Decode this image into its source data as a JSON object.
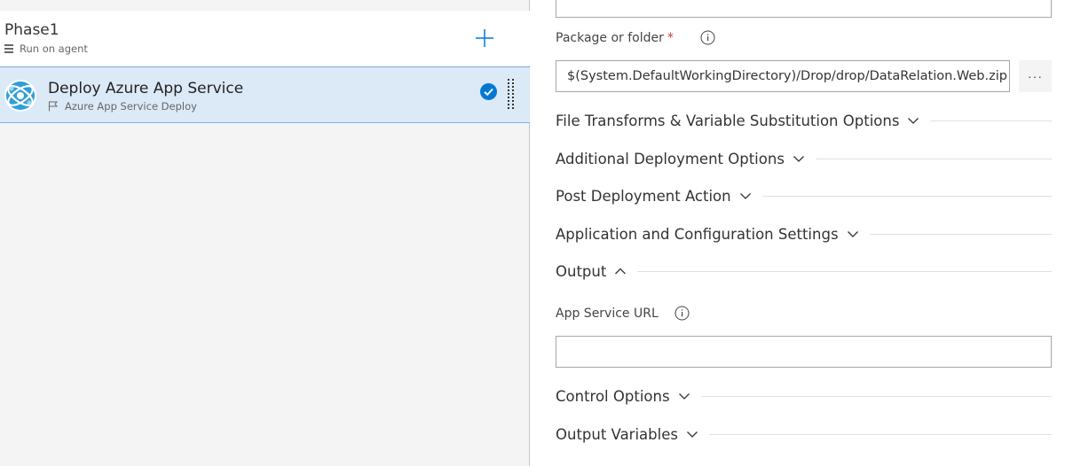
{
  "left": {
    "phase": {
      "title": "Phase1",
      "subtitle": "Run on agent",
      "add_icon": "plus-icon"
    },
    "task": {
      "title": "Deploy Azure App Service",
      "subtitle": "Azure App Service Deploy",
      "icon": "azure-app-service-icon",
      "status_icon": "checkmark-circle-icon",
      "handle_icon": "drag-handle-icon"
    }
  },
  "right": {
    "package": {
      "label": "Package or folder",
      "required_mark": "*",
      "value": "$(System.DefaultWorkingDirectory)/Drop/drop/DataRelation.Web.zip",
      "browse_label": "···"
    },
    "sections": [
      {
        "label": "File Transforms & Variable Substitution Options",
        "expanded": false
      },
      {
        "label": "Additional Deployment Options",
        "expanded": false
      },
      {
        "label": "Post Deployment Action",
        "expanded": false
      },
      {
        "label": "Application and Configuration Settings",
        "expanded": false
      },
      {
        "label": "Output",
        "expanded": true
      },
      {
        "label": "Control Options",
        "expanded": false
      },
      {
        "label": "Output Variables",
        "expanded": false
      }
    ],
    "app_service_url": {
      "label": "App Service URL",
      "value": ""
    }
  },
  "colors": {
    "accent": "#0078d4",
    "selected_row": "#dce9f7",
    "required": "#d13438"
  }
}
